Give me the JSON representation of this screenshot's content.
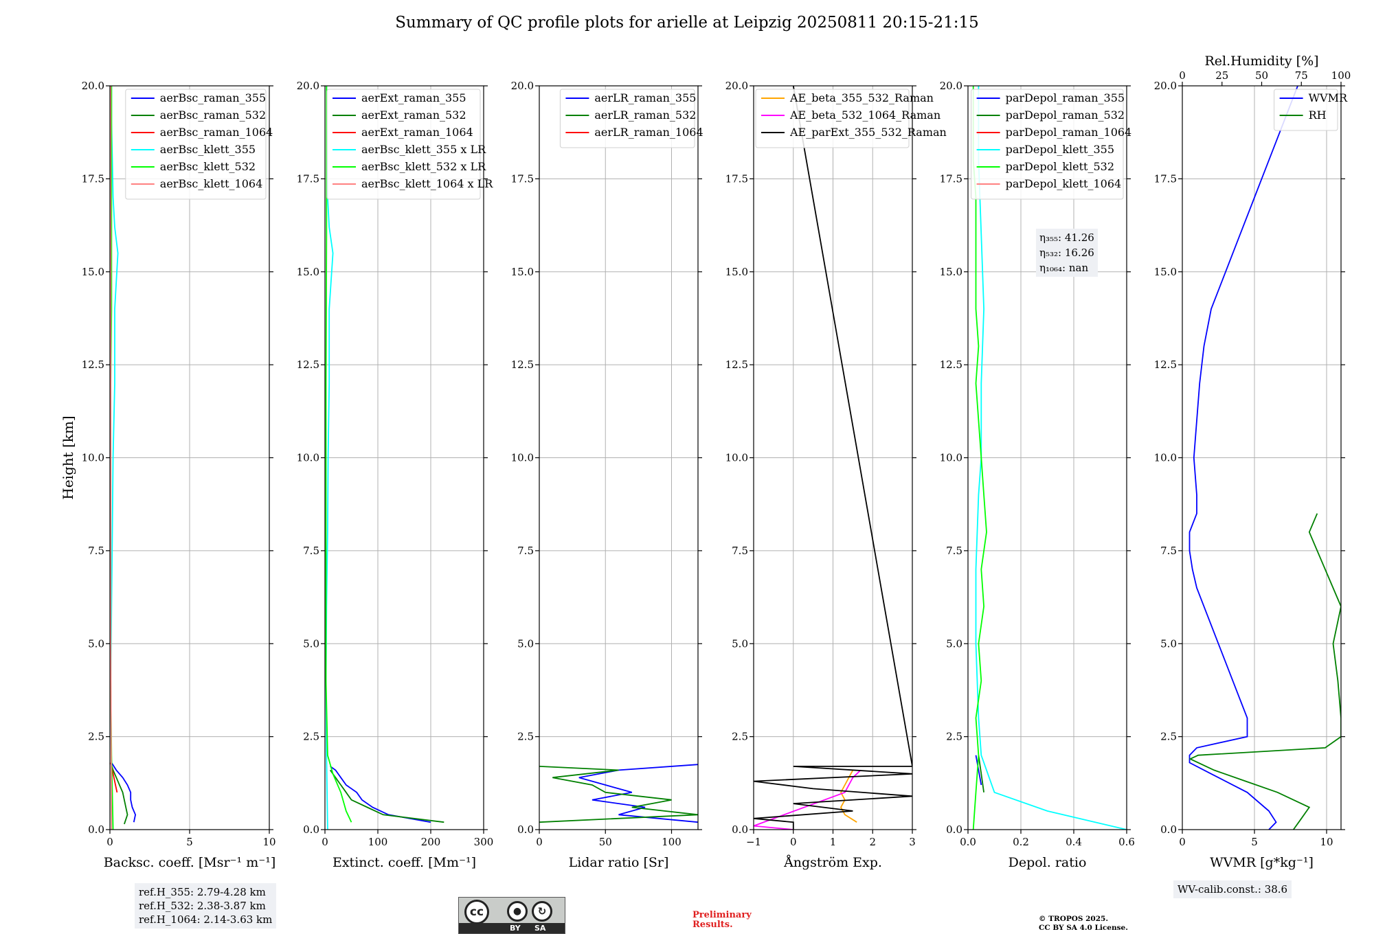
{
  "figure": {
    "title": "Summary of QC profile plots for arielle at Leipzig 20250811 20:15-21:15",
    "ylabel": "Height [km]",
    "ytick_labels": [
      "0.0",
      "2.5",
      "5.0",
      "7.5",
      "10.0",
      "12.5",
      "15.0",
      "17.5",
      "20.0"
    ]
  },
  "refbox": [
    "ref.H_355: 2.79-4.28 km",
    "ref.H_532: 2.38-3.87 km",
    "ref.H_1064: 2.14-3.63 km"
  ],
  "wv_calib": "WV-calib.const.: 38.6",
  "eta": {
    "l355": "η₃₅₅: 41.26",
    "l532": "η₅₃₂: 16.26",
    "l1064": "η₁₀₆₄: nan"
  },
  "license": {
    "cc": "cc",
    "by": "BY",
    "sa": "SA"
  },
  "preliminary": [
    "Preliminary",
    "Results."
  ],
  "copyright": [
    "© TROPOS 2025.",
    "CC BY SA 4.0 License."
  ],
  "colors": {
    "blue": "#0000ff",
    "green": "#008000",
    "red": "#ff0000",
    "cyan": "#00ffff",
    "lime": "#00ff00",
    "pink": "#ff8080",
    "orange": "#ffa500",
    "magenta": "#ff00ff",
    "black": "#000000"
  },
  "chart_data": [
    {
      "type": "line",
      "xlabel": "Backsc. coeff. [Msr⁻¹ m⁻¹]",
      "xlim": [
        0,
        10
      ],
      "ylim": [
        0,
        20
      ],
      "xticks": [
        0,
        5,
        10
      ],
      "xtick_labels": [
        "0",
        "5",
        "10"
      ],
      "legend": "top-right",
      "series": [
        {
          "name": "aerBsc_raman_355",
          "color": "#0000ff",
          "y": [
            0.2,
            0.4,
            0.6,
            0.8,
            1.0,
            1.2,
            1.4,
            1.6,
            1.8
          ],
          "x": [
            1.5,
            1.6,
            1.4,
            1.3,
            1.3,
            1.1,
            0.8,
            0.4,
            0.1
          ]
        },
        {
          "name": "aerBsc_raman_532",
          "color": "#008000",
          "y": [
            0.15,
            0.4,
            0.6,
            0.8,
            1.0,
            1.2,
            1.4,
            1.6,
            1.8
          ],
          "x": [
            0.9,
            1.1,
            1.0,
            0.9,
            0.8,
            0.6,
            0.4,
            0.2,
            0.05
          ]
        },
        {
          "name": "aerBsc_raman_1064",
          "color": "#ff0000",
          "y": [
            1.0,
            1.2,
            1.4,
            1.6,
            1.8
          ],
          "x": [
            0.45,
            0.35,
            0.25,
            0.15,
            0.05
          ]
        },
        {
          "name": "aerBsc_klett_355",
          "color": "#00ffff",
          "y": [
            0,
            2,
            4,
            6,
            8,
            10,
            12,
            14,
            15.5,
            16.2,
            17,
            18,
            19,
            20
          ],
          "x": [
            0.1,
            0.08,
            0.05,
            0.1,
            0.15,
            0.2,
            0.3,
            0.3,
            0.5,
            0.3,
            0.2,
            0.15,
            0.1,
            0.1
          ]
        },
        {
          "name": "aerBsc_klett_532",
          "color": "#00ff00",
          "y": [
            0,
            2,
            4,
            6,
            8,
            10,
            12,
            14,
            16,
            18,
            20
          ],
          "x": [
            0.2,
            0.1,
            0.05,
            0.05,
            0.05,
            0.05,
            0.05,
            0.1,
            0.1,
            0.1,
            0.1
          ]
        },
        {
          "name": "aerBsc_klett_1064",
          "color": "#ff8080",
          "y": [
            0,
            5,
            10,
            15,
            20
          ],
          "x": [
            0.1,
            0.05,
            0.05,
            0.05,
            0.05
          ]
        }
      ]
    },
    {
      "type": "line",
      "xlabel": "Extinct. coeff. [Mm⁻¹]",
      "xlim": [
        0,
        300
      ],
      "ylim": [
        0,
        20
      ],
      "xticks": [
        0,
        100,
        200,
        300
      ],
      "xtick_labels": [
        "0",
        "100",
        "200",
        "300"
      ],
      "legend": "top-right",
      "series": [
        {
          "name": "aerExt_raman_355",
          "color": "#0000ff",
          "y": [
            0.2,
            0.4,
            0.6,
            0.8,
            1.0,
            1.2,
            1.4,
            1.6,
            1.7
          ],
          "x": [
            200,
            120,
            90,
            70,
            60,
            40,
            30,
            20,
            10
          ]
        },
        {
          "name": "aerExt_raman_532",
          "color": "#008000",
          "y": [
            0.2,
            0.4,
            0.6,
            0.8,
            1.0,
            1.2,
            1.4,
            1.6
          ],
          "x": [
            225,
            110,
            80,
            50,
            40,
            30,
            20,
            10
          ]
        },
        {
          "name": "aerExt_raman_1064",
          "color": "#ff0000",
          "y": [],
          "x": []
        },
        {
          "name": "aerBsc_klett_355 x LR",
          "color": "#00ffff",
          "y": [
            0,
            2,
            4,
            6,
            8,
            10,
            12,
            14,
            15.5,
            16.2,
            17,
            18,
            20
          ],
          "x": [
            5,
            3,
            2,
            3,
            5,
            6,
            8,
            8,
            15,
            8,
            5,
            4,
            3
          ]
        },
        {
          "name": "aerBsc_klett_532 x LR",
          "color": "#00ff00",
          "y": [
            0.2,
            0.5,
            1,
            1.5,
            2,
            4,
            8,
            12,
            16,
            20
          ],
          "x": [
            50,
            40,
            30,
            15,
            5,
            2,
            2,
            2,
            3,
            3
          ]
        },
        {
          "name": "aerBsc_klett_1064 x LR",
          "color": "#ff8080",
          "y": [],
          "x": []
        }
      ]
    },
    {
      "type": "line",
      "xlabel": "Lidar ratio [Sr]",
      "xlim": [
        0,
        120
      ],
      "ylim": [
        0,
        20
      ],
      "xticks": [
        0,
        50,
        100
      ],
      "xtick_labels": [
        "0",
        "50",
        "100"
      ],
      "legend": "top-right",
      "series": [
        {
          "name": "aerLR_raman_355",
          "color": "#0000ff",
          "y": [
            0.2,
            0.4,
            0.6,
            0.8,
            1.0,
            1.2,
            1.4,
            1.6,
            1.75
          ],
          "x": [
            120,
            60,
            80,
            40,
            70,
            50,
            30,
            60,
            120
          ]
        },
        {
          "name": "aerLR_raman_532",
          "color": "#008000",
          "y": [
            0.2,
            0.4,
            0.6,
            0.8,
            1.0,
            1.2,
            1.4,
            1.6,
            1.7
          ],
          "x": [
            0,
            120,
            70,
            100,
            50,
            40,
            10,
            60,
            0
          ]
        },
        {
          "name": "aerLR_raman_1064",
          "color": "#ff0000",
          "y": [],
          "x": []
        }
      ]
    },
    {
      "type": "line",
      "xlabel": "Ångström Exp.",
      "xlim": [
        -1,
        3
      ],
      "ylim": [
        0,
        20
      ],
      "xticks": [
        -1,
        0,
        1,
        2,
        3
      ],
      "xtick_labels": [
        "−1",
        "0",
        "1",
        "2",
        "3"
      ],
      "legend": "top-right",
      "series": [
        {
          "name": "AE_beta_355_532_Raman",
          "color": "#ffa500",
          "y": [
            0.2,
            0.4,
            0.6,
            0.8,
            1.0,
            1.2,
            1.4,
            1.6
          ],
          "x": [
            1.6,
            1.3,
            1.2,
            1.3,
            1.2,
            1.3,
            1.4,
            1.5
          ]
        },
        {
          "name": "AE_beta_532_1064_Raman",
          "color": "#ff00ff",
          "y": [
            0,
            0.1,
            1.0,
            1.2,
            1.4,
            1.6
          ],
          "x": [
            0,
            -1,
            1.3,
            1.4,
            1.5,
            1.7
          ]
        },
        {
          "name": "AE_parExt_355_532_Raman",
          "color": "#000000",
          "y": [
            0,
            0.2,
            0.3,
            0.5,
            0.7,
            0.9,
            1.1,
            1.3,
            1.5,
            1.7,
            1.7,
            20
          ],
          "x": [
            0,
            0,
            -1,
            1.5,
            0,
            3,
            0.5,
            -1,
            3,
            0,
            3,
            0
          ]
        }
      ]
    },
    {
      "type": "line",
      "xlabel": "Depol. ratio",
      "xlim": [
        0,
        0.6
      ],
      "ylim": [
        0,
        20
      ],
      "xticks": [
        0,
        0.2,
        0.4,
        0.6
      ],
      "xtick_labels": [
        "0.0",
        "0.2",
        "0.4",
        "0.6"
      ],
      "legend": "top-right",
      "series": [
        {
          "name": "parDepol_raman_355",
          "color": "#0000ff",
          "y": [
            1.2,
            1.6,
            2.0
          ],
          "x": [
            0.05,
            0.04,
            0.03
          ]
        },
        {
          "name": "parDepol_raman_532",
          "color": "#008000",
          "y": [
            1.0,
            1.5,
            2.0
          ],
          "x": [
            0.06,
            0.05,
            0.04
          ]
        },
        {
          "name": "parDepol_raman_1064",
          "color": "#ff0000",
          "y": [],
          "x": []
        },
        {
          "name": "parDepol_klett_355",
          "color": "#00ffff",
          "y": [
            0,
            0.5,
            1,
            2,
            3,
            5,
            7,
            9,
            10,
            12,
            14,
            16,
            18,
            20
          ],
          "x": [
            0.6,
            0.3,
            0.1,
            0.05,
            0.04,
            0.03,
            0.03,
            0.04,
            0.05,
            0.05,
            0.06,
            0.05,
            0.04,
            0.04
          ]
        },
        {
          "name": "parDepol_klett_532",
          "color": "#00ff00",
          "y": [
            0,
            1,
            2,
            3,
            4,
            5,
            6,
            7,
            8,
            9,
            10,
            11,
            12,
            13,
            14,
            15,
            16,
            17,
            18,
            19,
            20
          ],
          "x": [
            0.02,
            0.03,
            0.04,
            0.03,
            0.05,
            0.04,
            0.06,
            0.05,
            0.07,
            0.06,
            0.05,
            0.04,
            0.03,
            0.04,
            0.03,
            0.03,
            0.03,
            0.03,
            0.02,
            0.02,
            0.02
          ]
        },
        {
          "name": "parDepol_klett_1064",
          "color": "#ff8080",
          "y": [],
          "x": []
        }
      ]
    },
    {
      "type": "line",
      "xlabel": "WVMR [g*kg⁻¹]",
      "xlim": [
        0,
        11
      ],
      "ylim": [
        0,
        20
      ],
      "xticks": [
        0,
        5,
        10
      ],
      "xtick_labels": [
        "0",
        "5",
        "10"
      ],
      "top_xlabel": "Rel.Humidity [%]",
      "top_xlim": [
        0,
        100
      ],
      "top_xticks": [
        0,
        25,
        50,
        75,
        100
      ],
      "top_xtick_labels": [
        "0",
        "25",
        "50",
        "75",
        "100"
      ],
      "legend": "top-right",
      "series": [
        {
          "name": "WVMR",
          "color": "#0000ff",
          "axis": "bottom",
          "y": [
            0,
            0.2,
            0.5,
            1.0,
            1.5,
            1.8,
            2.0,
            2.2,
            2.5,
            3,
            3.5,
            4,
            4.5,
            5,
            5.5,
            6,
            6.5,
            7,
            7.5,
            8,
            8.5,
            9,
            10,
            11,
            12,
            13,
            14,
            15,
            16,
            17,
            18,
            19,
            20
          ],
          "x": [
            6,
            6.5,
            6.0,
            4.5,
            2,
            0.5,
            0.5,
            1,
            4.5,
            4.5,
            4,
            3.5,
            3,
            2.5,
            2,
            1.5,
            1,
            0.7,
            0.5,
            0.5,
            1,
            1,
            0.8,
            1,
            1.2,
            1.5,
            2,
            3,
            4,
            5,
            6,
            7,
            8
          ]
        },
        {
          "name": "RH",
          "color": "#008000",
          "axis": "top",
          "y": [
            0,
            0.3,
            0.6,
            1.0,
            1.3,
            1.6,
            1.9,
            2.0,
            2.2,
            2.5,
            3,
            4,
            5,
            6,
            7,
            8,
            8.5
          ],
          "x": [
            70,
            75,
            80,
            60,
            40,
            20,
            5,
            10,
            90,
            100,
            100,
            98,
            95,
            100,
            90,
            80,
            85
          ]
        }
      ]
    }
  ]
}
